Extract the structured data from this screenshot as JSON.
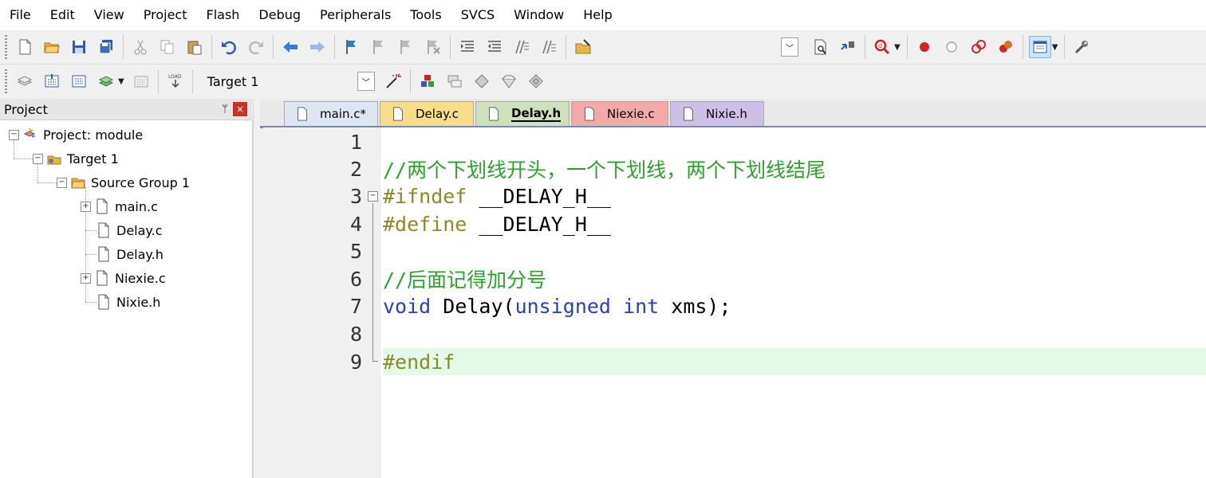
{
  "menu": [
    "File",
    "Edit",
    "View",
    "Project",
    "Flash",
    "Debug",
    "Peripherals",
    "Tools",
    "SVCS",
    "Window",
    "Help"
  ],
  "toolbar2": {
    "target": "Target 1",
    "load_label": "LOAD"
  },
  "project_panel": {
    "title": "Project",
    "pin": "ᛘ",
    "close": "×",
    "tree": {
      "root": "Project: module",
      "target": "Target 1",
      "group": "Source Group 1",
      "files": [
        "main.c",
        "Delay.c",
        "Delay.h",
        "Niexie.c",
        "Nixie.h"
      ]
    }
  },
  "tabs": [
    {
      "label": "main.c*",
      "color": "#dfe6f3"
    },
    {
      "label": "Delay.c",
      "color": "#f6de88"
    },
    {
      "label": "Delay.h",
      "color": "#cfe0bf"
    },
    {
      "label": "Niexie.c",
      "color": "#f3a9a9"
    },
    {
      "label": "Nixie.h",
      "color": "#cdbfe6"
    }
  ],
  "code": {
    "line_numbers": [
      "1",
      "2",
      "3",
      "4",
      "5",
      "6",
      "7",
      "8",
      "9"
    ],
    "lines": {
      "l2": "//两个下划线开头，一个下划线，两个下划线结尾",
      "l3_pp": "#ifndef",
      "l3_rest": " __DELAY_H__",
      "l4_pp": "#define",
      "l4_rest": " __DELAY_H__",
      "l6": "//后面记得加分号",
      "l7_kw1": "void",
      "l7_mid": " Delay(",
      "l7_kw2": "unsigned",
      "l7_sp": " ",
      "l7_kw3": "int",
      "l7_end": " xms);",
      "l9": "#endif"
    }
  }
}
